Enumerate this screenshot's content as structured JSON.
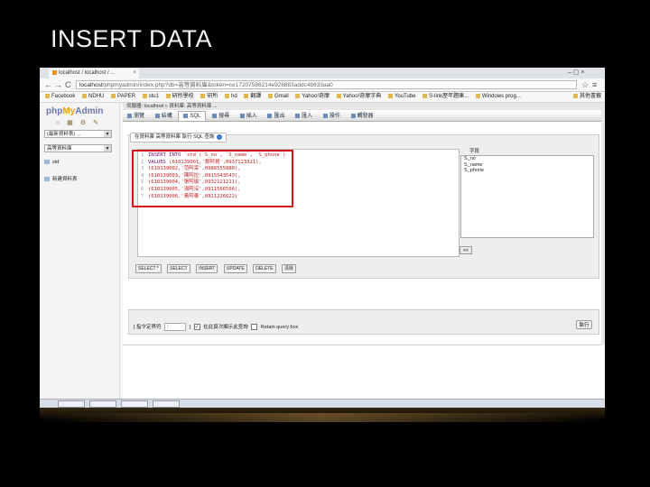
{
  "slide": {
    "title": "INSERT DATA"
  },
  "browser": {
    "tab_title": "localhost / localhost / ...",
    "tab_close": "×",
    "url_host": "localhost",
    "url_path": "/phpmyadmin/index.php?db=高等資料庫&token=ce17207586214e926883addc4b633aa0",
    "nav_back": "←",
    "nav_forward": "→",
    "nav_reload": "C",
    "star": "☆",
    "window_controls": "–  ▢  ×",
    "bookmarks": [
      "Facebook",
      "NDHU",
      "PAPER",
      "stu1",
      "研所學校",
      "研所",
      "hd",
      "翻譯",
      "Gmail",
      "Yahoo!奇摩",
      "Yahoo!奇摩字典",
      "YouTube",
      "S-link歷年題庫...",
      "Windows prog..."
    ],
    "bookmarks_other": "其他書籤"
  },
  "sidebar": {
    "logo_php": "php",
    "logo_my": "My",
    "logo_admin": "Admin",
    "icons": "⌂ ▦ ⚙ ✎",
    "select_recent": "(最新資料表) ...",
    "select_db": "高等資料庫",
    "table_item": "std",
    "new_table": "新建資料表"
  },
  "main": {
    "breadcrumb": "伺服器: localhost  »  資料庫: 高等資料庫 ...",
    "tabs": [
      {
        "label": "瀏覽",
        "active": false
      },
      {
        "label": "結構",
        "active": false
      },
      {
        "label": "SQL",
        "active": true
      },
      {
        "label": "搜尋",
        "active": false
      },
      {
        "label": "插入",
        "active": false
      },
      {
        "label": "匯出",
        "active": false
      },
      {
        "label": "匯入",
        "active": false
      },
      {
        "label": "操作",
        "active": false
      },
      {
        "label": "觸發器",
        "active": false
      }
    ],
    "legend": "在資料庫 高等資料庫 執行 SQL 查詢",
    "code_lines": [
      {
        "n": "1",
        "a": "INSERT INTO ",
        "b": "`std`(`S_no`, `S_name`, `S_phone`)"
      },
      {
        "n": "2",
        "a": "VALUES ",
        "b": "(610139001,'鄭阿哥',0937123321),"
      },
      {
        "n": "3",
        "a": "",
        "b": "(610139002,'范阿呆',0988555888),"
      },
      {
        "n": "4",
        "a": "",
        "b": "(610139003,'陳阿拉',0915543543),"
      },
      {
        "n": "5",
        "a": "",
        "b": "(610139004,'張阿瑜',0932121211),"
      },
      {
        "n": "6",
        "a": "",
        "b": "(610139005,'湯阿沒',0911566566),"
      },
      {
        "n": "7",
        "a": "",
        "b": "(610139006,'黃阿泰',0921226622)"
      }
    ],
    "fields_label": "字段",
    "fields": [
      "S_no",
      "S_name",
      "S_phone"
    ],
    "insert_field_btn": "<<",
    "sql_buttons": [
      "SELECT *",
      "SELECT",
      "INSERT",
      "UPDATE",
      "DELETE",
      "清除"
    ],
    "delimiter_label": "[ 指令定界符",
    "delimiter_value": ";",
    "delimiter_close": "]",
    "show_again_label": "在此頁次顯示此查詢",
    "retain_label": "Retain query box",
    "go_button": "執行"
  }
}
